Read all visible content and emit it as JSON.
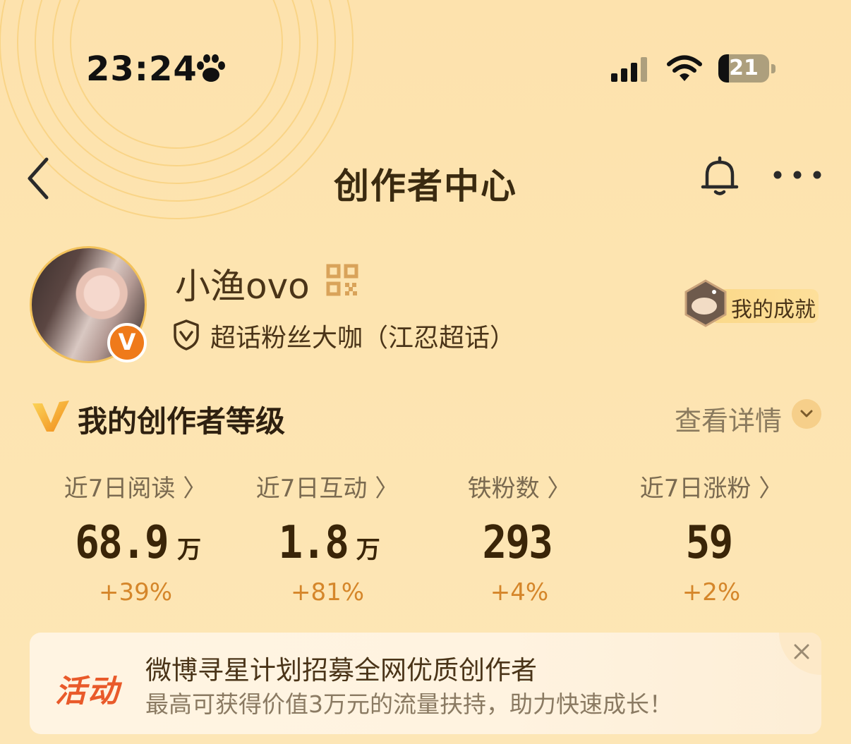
{
  "status_bar": {
    "time": "23:24",
    "battery": "21",
    "battery_level": 0.21
  },
  "nav": {
    "title": "创作者中心"
  },
  "profile": {
    "username": "小渔ovo",
    "badge": "V",
    "fan_title": "超话粉丝大咖（江忍超话）",
    "achievement_label": "我的成就"
  },
  "level": {
    "title": "我的创作者等级",
    "details_label": "查看详情"
  },
  "stats": [
    {
      "label": "近7日阅读 〉",
      "value": "68.9",
      "unit": "万",
      "change": "+39%"
    },
    {
      "label": "近7日互动 〉",
      "value": "1.8",
      "unit": "万",
      "change": "+81%"
    },
    {
      "label": "铁粉数 〉",
      "value": "293",
      "unit": "",
      "change": "+4%"
    },
    {
      "label": "近7日涨粉 〉",
      "value": "59",
      "unit": "",
      "change": "+2%"
    }
  ],
  "banner": {
    "tag": "活动",
    "title": "微博寻星计划招募全网优质创作者",
    "subtitle": "最高可获得价值3万元的流量扶持，助力快速成长！"
  },
  "colors": {
    "accent": "#d5862a",
    "badge_orange": "#ef7a1a",
    "tag_red": "#e95a2a",
    "background": "#fde2ad"
  },
  "icons": [
    "paw-icon",
    "signal-icon",
    "wifi-icon",
    "battery-icon",
    "back-icon",
    "bell-icon",
    "more-icon",
    "qr-code-icon",
    "shield-icon",
    "achievement-icon",
    "v-level-icon",
    "chevron-down-icon",
    "close-icon"
  ]
}
